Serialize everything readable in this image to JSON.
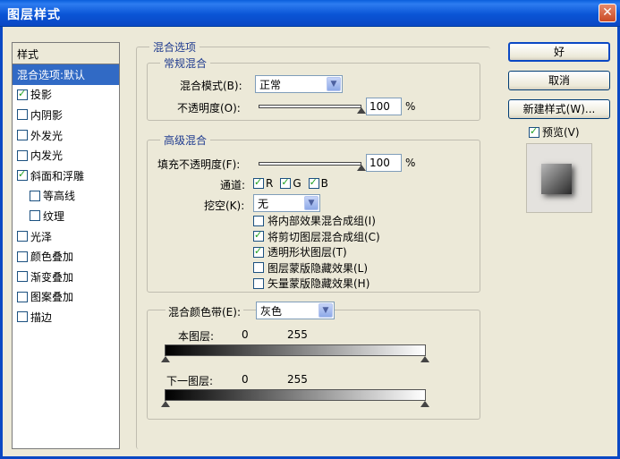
{
  "window": {
    "title": "图层样式",
    "close_glyph": "✕"
  },
  "stylelist": {
    "header": "样式",
    "items": [
      {
        "label": "混合选项:默认",
        "checkbox": false,
        "checked": false,
        "selected": true,
        "indent": false
      },
      {
        "label": "投影",
        "checkbox": true,
        "checked": true,
        "selected": false,
        "indent": false
      },
      {
        "label": "内阴影",
        "checkbox": true,
        "checked": false,
        "selected": false,
        "indent": false
      },
      {
        "label": "外发光",
        "checkbox": true,
        "checked": false,
        "selected": false,
        "indent": false
      },
      {
        "label": "内发光",
        "checkbox": true,
        "checked": false,
        "selected": false,
        "indent": false
      },
      {
        "label": "斜面和浮雕",
        "checkbox": true,
        "checked": true,
        "selected": false,
        "indent": false
      },
      {
        "label": "等高线",
        "checkbox": true,
        "checked": false,
        "selected": false,
        "indent": true
      },
      {
        "label": "纹理",
        "checkbox": true,
        "checked": false,
        "selected": false,
        "indent": true
      },
      {
        "label": "光泽",
        "checkbox": true,
        "checked": false,
        "selected": false,
        "indent": false
      },
      {
        "label": "颜色叠加",
        "checkbox": true,
        "checked": false,
        "selected": false,
        "indent": false
      },
      {
        "label": "渐变叠加",
        "checkbox": true,
        "checked": false,
        "selected": false,
        "indent": false
      },
      {
        "label": "图案叠加",
        "checkbox": true,
        "checked": false,
        "selected": false,
        "indent": false
      },
      {
        "label": "描边",
        "checkbox": true,
        "checked": false,
        "selected": false,
        "indent": false
      }
    ]
  },
  "blend": {
    "section_title": "混合选项",
    "general": {
      "title": "常规混合",
      "mode_label": "混合模式(B):",
      "mode_value": "正常",
      "opacity_label": "不透明度(O):",
      "opacity_value": "100",
      "opacity_pct": 1.0,
      "unit": "%"
    },
    "advanced": {
      "title": "高级混合",
      "fill_label": "填充不透明度(F):",
      "fill_value": "100",
      "fill_pct": 1.0,
      "unit": "%",
      "channels_label": "通道:",
      "channels": [
        {
          "label": "R",
          "checked": true
        },
        {
          "label": "G",
          "checked": true
        },
        {
          "label": "B",
          "checked": true
        }
      ],
      "knockout_label": "挖空(K):",
      "knockout_value": "无",
      "options": [
        {
          "label": "将内部效果混合成组(I)",
          "checked": false
        },
        {
          "label": "将剪切图层混合成组(C)",
          "checked": true
        },
        {
          "label": "透明形状图层(T)",
          "checked": true
        },
        {
          "label": "图层蒙版隐藏效果(L)",
          "checked": false
        },
        {
          "label": "矢量蒙版隐藏效果(H)",
          "checked": false
        }
      ]
    },
    "blendif": {
      "label": "混合颜色带(E):",
      "value": "灰色",
      "this_layer": {
        "label": "本图层:",
        "min": "0",
        "max": "255"
      },
      "underlying": {
        "label": "下一图层:",
        "min": "0",
        "max": "255"
      }
    }
  },
  "buttons": {
    "ok": "好",
    "cancel": "取消",
    "new_style": "新建样式(W)..."
  },
  "preview": {
    "label": "预览(V)",
    "checked": true
  },
  "colors": {
    "title_blue": "#0a55d6",
    "selected_bg": "#316ac5",
    "dialog_bg": "#ece9d8",
    "legend_text": "#1f3b8f",
    "check_green": "#21a121"
  }
}
